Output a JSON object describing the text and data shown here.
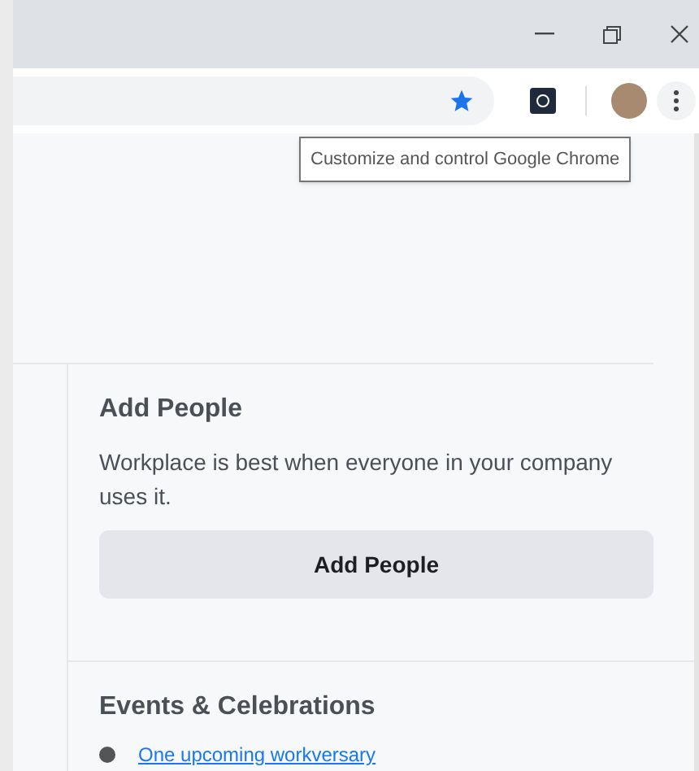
{
  "tooltip": "Customize and control Google Chrome",
  "add_people": {
    "title": "Add People",
    "text": "Workplace is best when everyone in your company uses it.",
    "button": "Add People"
  },
  "events": {
    "title": "Events & Celebrations",
    "items": [
      {
        "text": "One upcoming workversary"
      }
    ]
  }
}
